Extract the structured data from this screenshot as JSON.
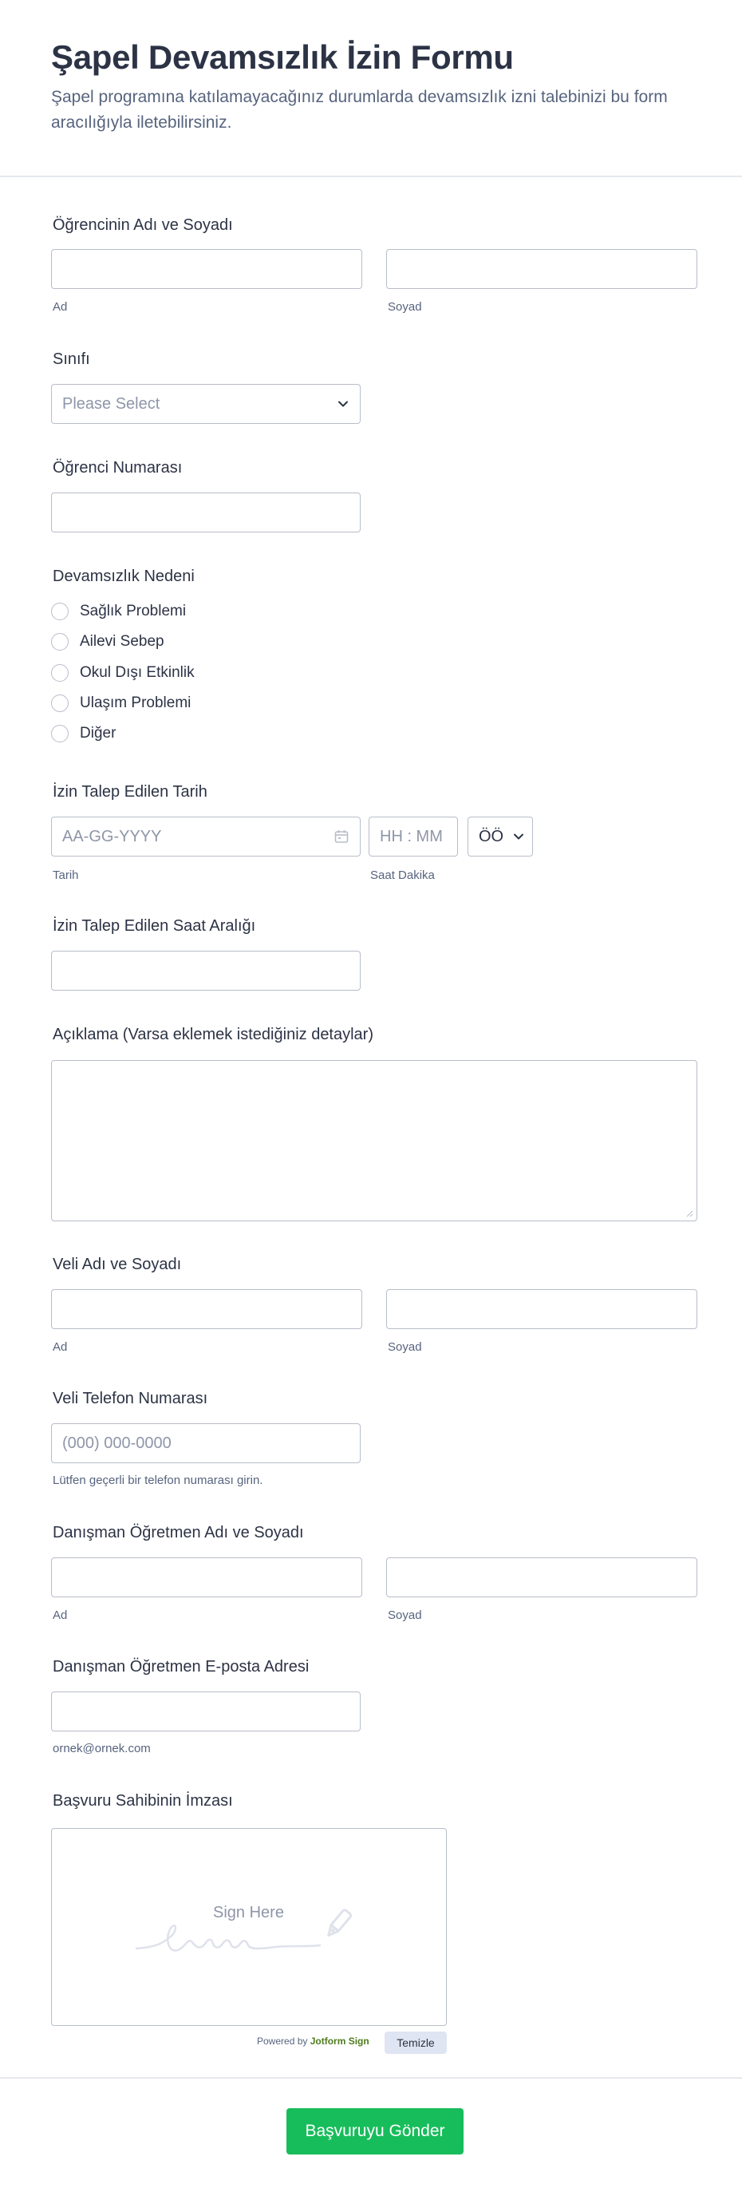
{
  "header": {
    "title": "Şapel Devamsızlık İzin Formu",
    "subtitle": "Şapel programına katılamayacağınız durumlarda devamsızlık izni talebinizi bu form aracılığıyla iletebilirsiniz."
  },
  "student_name": {
    "label": "Öğrencinin Adı ve Soyadı",
    "first_sub": "Ad",
    "last_sub": "Soyad"
  },
  "class": {
    "label": "Sınıfı",
    "placeholder": "Please Select"
  },
  "student_number": {
    "label": "Öğrenci Numarası"
  },
  "reason": {
    "label": "Devamsızlık Nedeni",
    "options": [
      "Sağlık Problemi",
      "Ailevi Sebep",
      "Okul Dışı Etkinlik",
      "Ulaşım Problemi",
      "Diğer"
    ]
  },
  "date": {
    "label": "İzin Talep Edilen Tarih",
    "date_placeholder": "AA-GG-YYYY",
    "time_placeholder": "HH : MM",
    "ampm_value": "ÖÖ",
    "date_sub": "Tarih",
    "time_sub": "Saat Dakika"
  },
  "time_range": {
    "label": "İzin Talep Edilen Saat Aralığı"
  },
  "description": {
    "label": "Açıklama (Varsa eklemek istediğiniz detaylar)"
  },
  "parent_name": {
    "label": "Veli Adı ve Soyadı",
    "first_sub": "Ad",
    "last_sub": "Soyad"
  },
  "parent_phone": {
    "label": "Veli Telefon Numarası",
    "placeholder": "(000) 000-0000",
    "sub": "Lütfen geçerli bir telefon numarası girin."
  },
  "advisor_name": {
    "label": "Danışman Öğretmen Adı ve Soyadı",
    "first_sub": "Ad",
    "last_sub": "Soyad"
  },
  "advisor_email": {
    "label": "Danışman Öğretmen E-posta Adresi",
    "sub": "ornek@ornek.com"
  },
  "signature": {
    "label": "Başvuru Sahibinin İmzası",
    "placeholder": "Sign Here",
    "powered_prefix": "Powered by",
    "powered_brand": "Jotform Sign",
    "clear_label": "Temizle"
  },
  "submit": {
    "label": "Başvuruyu Gönder"
  },
  "colors": {
    "submit": "#18bd5b",
    "border": "#b8bdc9",
    "text": "#2c3345",
    "muted": "#57647e",
    "clear_bg": "#e0e5f3"
  },
  "icons": {
    "select": "chevron-down-icon",
    "date": "calendar-icon",
    "signature": "pen-icon",
    "resize": "resize-grip-icon"
  }
}
